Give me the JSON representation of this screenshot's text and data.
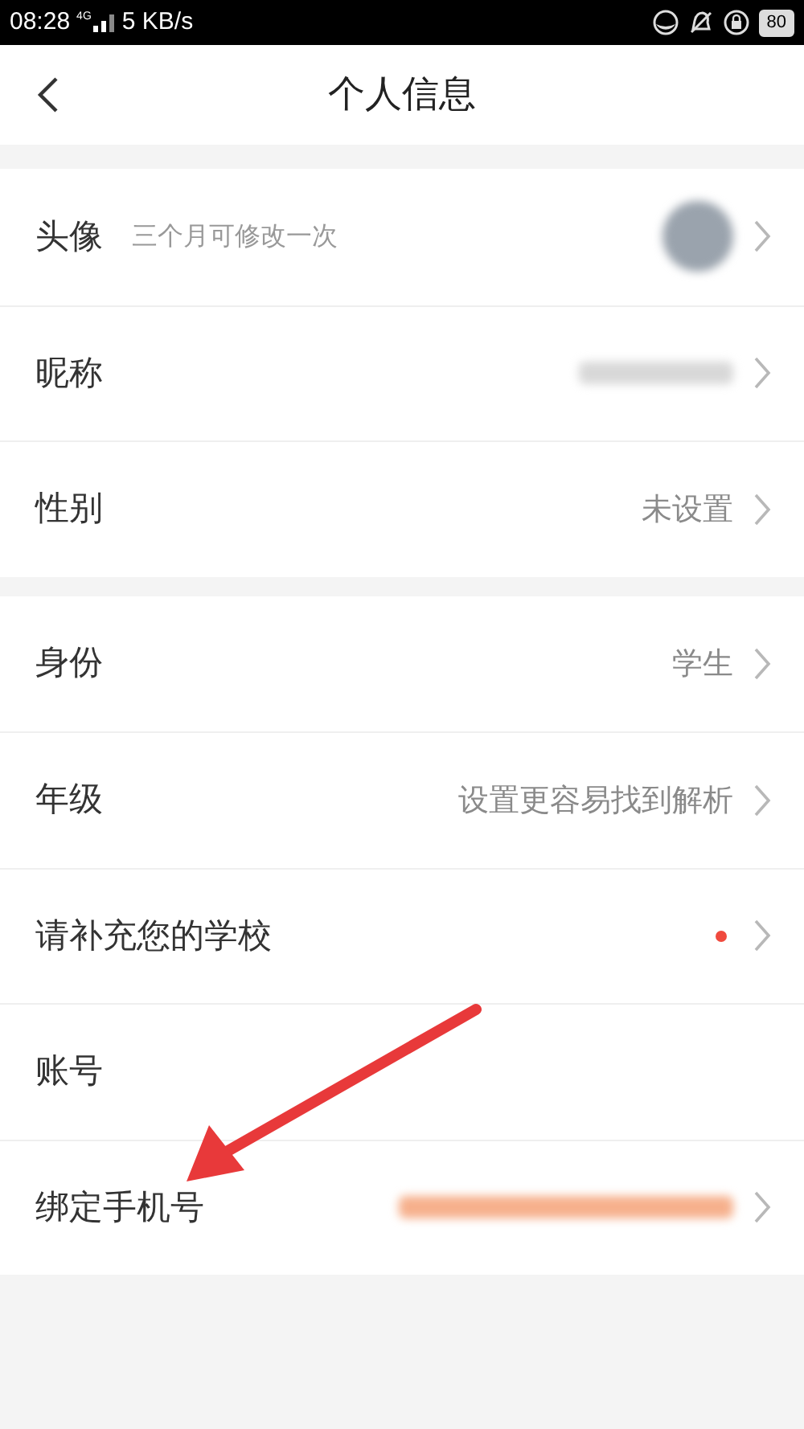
{
  "status_bar": {
    "time": "08:28",
    "network": "4G",
    "speed": "5 KB/s",
    "battery": "80"
  },
  "header": {
    "title": "个人信息"
  },
  "groups": [
    {
      "rows": [
        {
          "label": "头像",
          "hint": "三个月可修改一次",
          "kind": "avatar",
          "chevron": true
        },
        {
          "label": "昵称",
          "kind": "blurred",
          "chevron": true
        },
        {
          "label": "性别",
          "kind": "text",
          "value": "未设置",
          "chevron": true
        }
      ]
    },
    {
      "rows": [
        {
          "label": "身份",
          "kind": "text",
          "value": "学生",
          "chevron": true
        },
        {
          "label": "年级",
          "kind": "text",
          "value": "设置更容易找到解析",
          "chevron": true
        },
        {
          "label": "请补充您的学校",
          "kind": "dot",
          "color": "#f04a3e",
          "chevron": true
        },
        {
          "label": "账号",
          "kind": "none",
          "chevron": false
        },
        {
          "label": "绑定手机号",
          "kind": "blurred_orange",
          "chevron": true
        }
      ]
    }
  ]
}
